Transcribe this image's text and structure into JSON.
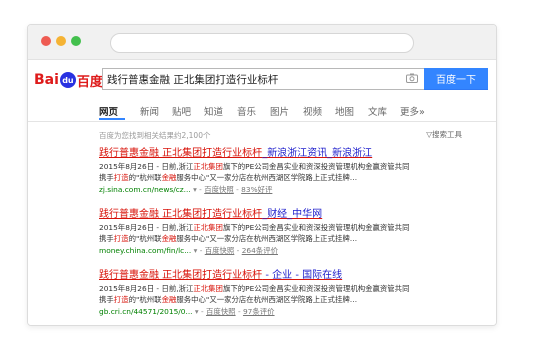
{
  "search": {
    "query": "践行普惠金融 正北集团打造行业标杆",
    "button_label": "百度一下"
  },
  "logo": {
    "part1": "Bai",
    "paw": "du",
    "part2": "百度"
  },
  "tabs": [
    "网页",
    "新闻",
    "贴吧",
    "知道",
    "音乐",
    "图片",
    "视频",
    "地图",
    "文库",
    "更多»"
  ],
  "stats": "百度为您找到相关结果约2,100个",
  "tools_label": "▽搜索工具",
  "results": [
    {
      "title_red": "践行普惠金融 正北集团打造行业标杆",
      "title_blue": "_新浪浙江资讯_新浪浙江",
      "line1_pre": "2015年8月26日 - 日前,浙江",
      "line1_hl": "正北集团",
      "line1_post": "旗下的PE公司金昌实业和资深投资管理机构金赢资管共同",
      "line2_a": "携手",
      "line2_b": "打造",
      "line2_c": "的\"杭州联",
      "line2_d": "金融",
      "line2_e": "服务中心\"又一家分店在杭州西湖区学院路上正式挂牌…",
      "url": "zj.sina.com.cn/news/cz...",
      "snapshot": "百度快照",
      "rating": "83%好评"
    },
    {
      "title_red": "践行普惠金融 正北集团打造行业标杆",
      "title_blue": "_财经_中华网",
      "line1_pre": "2015年8月26日 - 日前,浙江",
      "line1_hl": "正北集团",
      "line1_post": "旗下的PE公司金昌实业和资深投资管理机构金赢资管共同",
      "line2_a": "携手",
      "line2_b": "打造",
      "line2_c": "的\"杭州联",
      "line2_d": "金融",
      "line2_e": "服务中心\"又一家分店在杭州西湖区学院路上正式挂牌…",
      "url": "money.china.com/fin/lc...",
      "snapshot": "百度快照",
      "rating": "264条评价"
    },
    {
      "title_red": "践行普惠金融 正北集团打造行业标杆",
      "title_blue": " - 企业 - 国际在线",
      "line1_pre": "2015年8月26日 - 日前,浙江",
      "line1_hl": "正北集团",
      "line1_post": "旗下的PE公司金昌实业和资深投资管理机构金赢资管共同",
      "line2_a": "携手",
      "line2_b": "打造",
      "line2_c": "的\"杭州联",
      "line2_d": "金融",
      "line2_e": "服务中心\"又一家分店在杭州西湖区学院路上正式挂牌…",
      "url": "gb.cri.cn/44571/2015/0...",
      "snapshot": "百度快照",
      "rating": "97条评价"
    }
  ],
  "colors": {
    "accent": "#3385ff",
    "title_red": "#d8130a",
    "title_blue": "#2020cc",
    "url_green": "#008000",
    "logo_red": "#de1b1b",
    "logo_blue": "#2932e1"
  },
  "icons": {
    "camera": "camera-icon",
    "dropdown": "caret-down-icon"
  }
}
